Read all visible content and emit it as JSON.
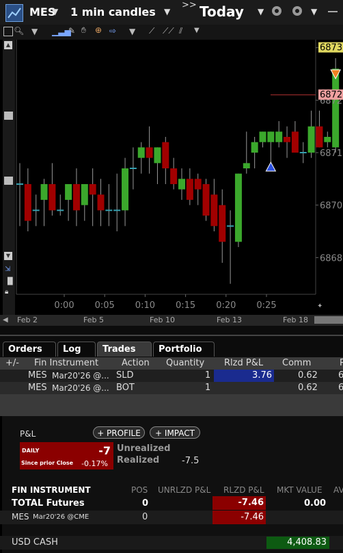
{
  "header": {
    "symbol": "MES",
    "interval": "1 min candles",
    "arrows": ">>",
    "period": "Today"
  },
  "chart_data": {
    "type": "candlestick",
    "candles": [
      {
        "o": 6870.7,
        "h": 6871.1,
        "l": 6869.9,
        "c": 6870.7
      },
      {
        "o": 6870.7,
        "h": 6871.0,
        "l": 6869.8,
        "c": 6870.0
      },
      {
        "o": 6870.2,
        "h": 6870.5,
        "l": 6869.9,
        "c": 6870.2
      },
      {
        "o": 6870.4,
        "h": 6870.8,
        "l": 6869.9,
        "c": 6870.7
      },
      {
        "o": 6870.7,
        "h": 6871.1,
        "l": 6870.1,
        "c": 6870.2
      },
      {
        "o": 6870.2,
        "h": 6870.5,
        "l": 6870.1,
        "c": 6870.2
      },
      {
        "o": 6870.4,
        "h": 6870.6,
        "l": 6870.0,
        "c": 6870.7
      },
      {
        "o": 6870.7,
        "h": 6871.0,
        "l": 6869.9,
        "c": 6870.2
      },
      {
        "o": 6870.3,
        "h": 6870.6,
        "l": 6870.0,
        "c": 6870.7
      },
      {
        "o": 6870.7,
        "h": 6871.0,
        "l": 6869.9,
        "c": 6870.5
      },
      {
        "o": 6870.5,
        "h": 6870.8,
        "l": 6869.9,
        "c": 6870.2
      },
      {
        "o": 6870.2,
        "h": 6870.7,
        "l": 6869.9,
        "c": 6870.2
      },
      {
        "o": 6870.2,
        "h": 6870.9,
        "l": 6869.8,
        "c": 6870.2
      },
      {
        "o": 6870.2,
        "h": 6871.2,
        "l": 6869.9,
        "c": 6871.0
      },
      {
        "o": 6871.0,
        "h": 6871.4,
        "l": 6870.6,
        "c": 6871.0
      },
      {
        "o": 6871.2,
        "h": 6871.5,
        "l": 6870.9,
        "c": 6871.4
      },
      {
        "o": 6871.4,
        "h": 6871.8,
        "l": 6870.9,
        "c": 6871.2
      },
      {
        "o": 6871.1,
        "h": 6871.4,
        "l": 6870.7,
        "c": 6871.4
      },
      {
        "o": 6871.5,
        "h": 6871.6,
        "l": 6870.7,
        "c": 6871.0
      },
      {
        "o": 6871.0,
        "h": 6871.2,
        "l": 6870.6,
        "c": 6870.7
      },
      {
        "o": 6870.6,
        "h": 6871.0,
        "l": 6870.4,
        "c": 6870.8
      },
      {
        "o": 6870.8,
        "h": 6871.0,
        "l": 6870.3,
        "c": 6870.4
      },
      {
        "o": 6870.8,
        "h": 6870.9,
        "l": 6870.3,
        "c": 6870.6
      },
      {
        "o": 6870.7,
        "h": 6870.8,
        "l": 6870.0,
        "c": 6870.1
      },
      {
        "o": 6870.5,
        "h": 6870.8,
        "l": 6869.8,
        "c": 6869.9
      },
      {
        "o": 6870.3,
        "h": 6870.6,
        "l": 6869.2,
        "c": 6869.6
      },
      {
        "o": 6869.9,
        "h": 6870.2,
        "l": 6868.8,
        "c": 6869.9
      },
      {
        "o": 6869.6,
        "h": 6870.9,
        "l": 6869.5,
        "c": 6870.9
      },
      {
        "o": 6871.0,
        "h": 6871.7,
        "l": 6870.9,
        "c": 6871.1
      },
      {
        "o": 6871.3,
        "h": 6871.6,
        "l": 6871.0,
        "c": 6871.5
      },
      {
        "o": 6871.5,
        "h": 6871.7,
        "l": 6871.4,
        "c": 6871.7
      },
      {
        "o": 6871.5,
        "h": 6871.7,
        "l": 6871.0,
        "c": 6871.7
      },
      {
        "o": 6871.5,
        "h": 6871.9,
        "l": 6871.4,
        "c": 6871.7
      },
      {
        "o": 6871.6,
        "h": 6871.8,
        "l": 6871.2,
        "c": 6871.5
      },
      {
        "o": 6871.7,
        "h": 6871.9,
        "l": 6871.3,
        "c": 6871.3
      },
      {
        "o": 6871.3,
        "h": 6871.5,
        "l": 6871.1,
        "c": 6871.3
      },
      {
        "o": 6871.3,
        "h": 6872.1,
        "l": 6871.2,
        "c": 6871.8
      },
      {
        "o": 6871.8,
        "h": 6872.1,
        "l": 6871.4,
        "c": 6871.4
      },
      {
        "o": 6871.5,
        "h": 6871.7,
        "l": 6871.4,
        "c": 6871.6
      },
      {
        "o": 6871.4,
        "h": 6873.1,
        "l": 6871.3,
        "c": 6872.9
      }
    ],
    "y_ticks": [
      "6873",
      "6872",
      "6871",
      "6870",
      "6868"
    ],
    "y_tick_values": [
      6873.3,
      6872.3,
      6871.3,
      6870.3,
      6869.3
    ],
    "ylim": [
      6868.6,
      6873.4
    ],
    "x_ticks": [
      "0:00",
      "0:05",
      "0:10",
      "0:15",
      "0:20",
      "0:25"
    ],
    "date_ticks": [
      "Feb 2",
      "Feb 5",
      "Feb 10",
      "Feb 13",
      "Feb 18"
    ],
    "last_price_label": "6873",
    "order_price_label": "6872",
    "markers": [
      {
        "type": "buy",
        "candle": 31
      },
      {
        "type": "sell",
        "candle": 39
      }
    ]
  },
  "tabs": [
    "Orders",
    "Log",
    "Trades",
    "Portfolio"
  ],
  "trades": {
    "columns": [
      "+/-",
      "Fin Instrument",
      "Action",
      "Quantity",
      "Rlzd P&L",
      "Comm",
      "P"
    ],
    "rows": [
      {
        "instrument": "MES",
        "detail": "Mar20'26 @...",
        "action": "SLD",
        "qty": "1",
        "rlzd": "3.76",
        "comm": "0.62",
        "extra": "6"
      },
      {
        "instrument": "MES",
        "detail": "Mar20'26 @...",
        "action": "BOT",
        "qty": "1",
        "rlzd": "",
        "comm": "0.62",
        "extra": "6"
      }
    ]
  },
  "pnl": {
    "title": "P&L",
    "profile_btn": "+ PROFILE",
    "impact_btn": "+ IMPACT",
    "daily_label": "DAILY",
    "daily_value": "-7",
    "since_label": "Since prior Close",
    "since_value": "-0.17%",
    "unrealized_label": "Unrealized",
    "realized_label": "Realized",
    "realized_value": "-7.5"
  },
  "portfolio": {
    "columns": [
      "FIN INSTRUMENT",
      "POS",
      "UNRLZD P&L",
      "RLZD P&L",
      "MKT VALUE",
      "AV"
    ],
    "total": {
      "name": "TOTAL Futures",
      "pos": "0",
      "rlzd": "-7.46",
      "mkt": "0.00"
    },
    "row": {
      "symbol": "MES",
      "detail": "Mar20'26 @CME",
      "pos": "0",
      "rlzd": "-7.46"
    },
    "cash_label": "USD CASH",
    "cash_value": "4,408.83"
  }
}
